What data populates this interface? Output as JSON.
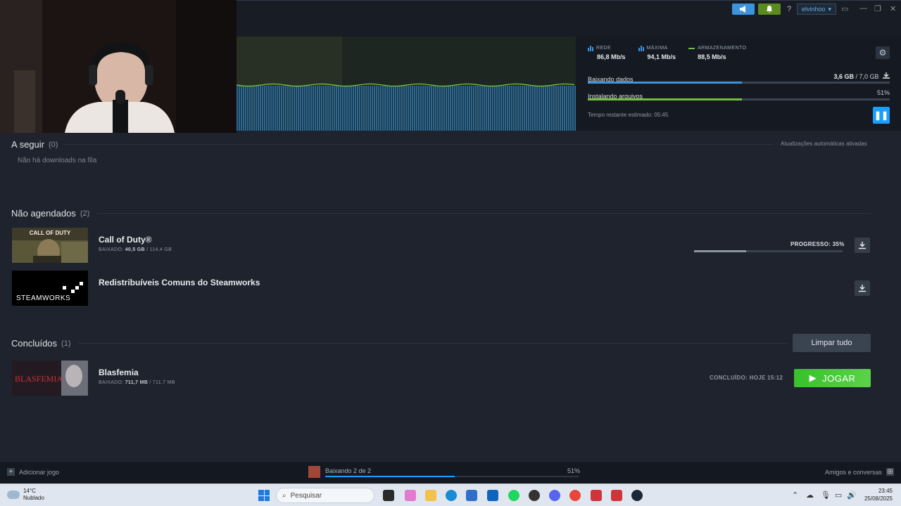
{
  "topbar": {
    "help_label": "?",
    "username": "elvinhoo",
    "min_icon": "minimize-icon",
    "max_icon": "maximize-icon",
    "close_icon": "close-icon"
  },
  "download": {
    "stats": [
      {
        "label": "REDE",
        "value": "86,8 Mb/s",
        "icon": "bars-icon",
        "color": "#3d93dc"
      },
      {
        "label": "MÁXIMA",
        "value": "94,1 Mb/s",
        "icon": "bars-icon",
        "color": "#3d93dc"
      },
      {
        "label": "ARMAZENAMENTO",
        "value": "88,5 Mb/s",
        "icon": "line-icon",
        "color": "#6fbf3a"
      }
    ],
    "downloading_label": "Baixando dados",
    "downloading_done": "3,6 GB",
    "downloading_sep": " / ",
    "downloading_total": "7,0 GB",
    "downloading_progress": 0.51,
    "installing_label": "Instalando arquivos",
    "installing_pct": "51%",
    "installing_progress": 0.51,
    "time_left": "Tempo restante estimado: 05:45",
    "colors": {
      "download": "#3d93dc",
      "install": "#6fbf3a"
    }
  },
  "queue": {
    "title": "A seguir",
    "count": "(0)",
    "auto_updates": "Atualizações automáticas ativadas",
    "empty": "Não há downloads na fila"
  },
  "unscheduled": {
    "title": "Não agendados",
    "count": "(2)",
    "games": [
      {
        "name": "Call of Duty®",
        "sub_label": "BAIXADO:",
        "sub_done": "40,5 GB",
        "sub_total": "/ 114,4 GB",
        "progress_label": "PROGRESSO: 35%",
        "progress": 0.35,
        "thumb_text": "CALL OF DUTY"
      },
      {
        "name": "Redistribuíveis Comuns do Steamworks",
        "thumb_text": "STEAMWORKS"
      }
    ]
  },
  "completed": {
    "title": "Concluídos",
    "count": "(1)",
    "clear_label": "Limpar tudo",
    "games": [
      {
        "name": "Blasfemia",
        "sub_label": "BAIXADO:",
        "sub_done": "711,7 MB",
        "sub_total": "/ 711,7 MB",
        "concluded": "CONCLUÍDO: HOJE 15:12",
        "play_label": "JOGAR",
        "thumb_text": "BLASFEMIA"
      }
    ]
  },
  "bottombar": {
    "add_game": "Adicionar jogo",
    "downloading": "Baixando 2 de 2",
    "pct": "51%",
    "progress": 0.51,
    "friends": "Amigos e conversas"
  },
  "taskbar": {
    "temp": "14°C",
    "weather": "Nublado",
    "search_placeholder": "Pesquisar",
    "time": "23:45",
    "date": "25/08/2025"
  }
}
